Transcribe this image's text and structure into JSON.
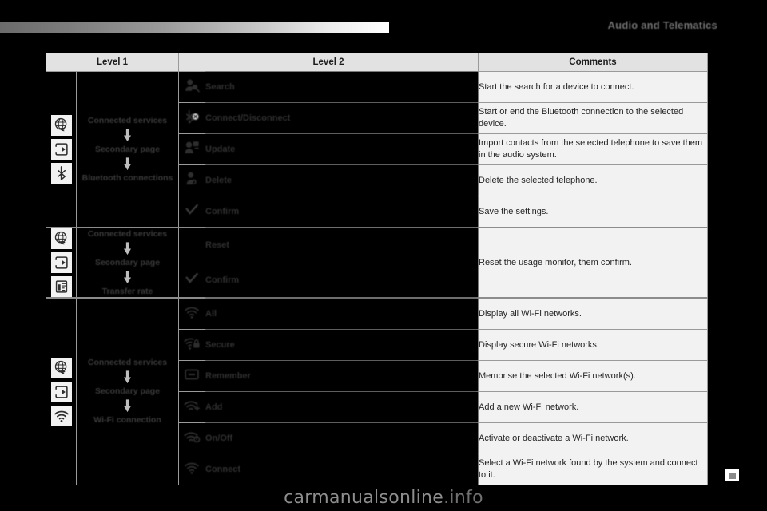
{
  "header": {
    "section_title": "Audio and Telematics"
  },
  "table": {
    "columns": {
      "level1": "Level 1",
      "level2": "Level 2",
      "comments": "Comments"
    },
    "groups": [
      {
        "level1": {
          "icons": [
            "globe-icon",
            "secondary-page-icon",
            "bluetooth-icon"
          ],
          "flow": [
            "Connected services",
            "Secondary page",
            "Bluetooth connections"
          ]
        },
        "rows": [
          {
            "icon": "search-person-icon",
            "label": "Search",
            "comment": "Start the search for a device to connect."
          },
          {
            "icon": "bluetooth-connect-icon",
            "label": "Connect/Disconnect",
            "comment": "Start or end the Bluetooth connection to the selected device."
          },
          {
            "icon": "update-contacts-icon",
            "label": "Update",
            "comment": "Import contacts from the selected telephone to save them in the audio system."
          },
          {
            "icon": "delete-person-icon",
            "label": "Delete",
            "comment": "Delete the selected telephone."
          },
          {
            "icon": "check-icon",
            "label": "Confirm",
            "comment": "Save the settings."
          }
        ]
      },
      {
        "level1": {
          "icons": [
            "globe-icon",
            "secondary-page-icon",
            "transfer-rate-icon"
          ],
          "flow": [
            "Connected services",
            "Secondary page",
            "Transfer rate"
          ]
        },
        "merged_comment": "Reset the usage monitor, them confirm.",
        "rows": [
          {
            "icon": "none",
            "label": "Reset"
          },
          {
            "icon": "check-icon",
            "label": "Confirm"
          }
        ]
      },
      {
        "level1": {
          "icons": [
            "globe-icon",
            "secondary-page-icon",
            "wifi-icon"
          ],
          "flow": [
            "Connected services",
            "Secondary page",
            "Wi-Fi connection"
          ]
        },
        "rows": [
          {
            "icon": "wifi-icon",
            "label": "All",
            "comment": "Display all Wi-Fi networks."
          },
          {
            "icon": "wifi-secure-icon",
            "label": "Secure",
            "comment": "Display secure Wi-Fi networks."
          },
          {
            "icon": "remember-icon",
            "label": "Remember",
            "comment": "Memorise the selected Wi-Fi network(s)."
          },
          {
            "icon": "wifi-add-icon",
            "label": "Add",
            "comment": "Add a new Wi-Fi network."
          },
          {
            "icon": "wifi-onoff-icon",
            "label": "On/Off",
            "comment": "Activate or deactivate a Wi-Fi network."
          },
          {
            "icon": "wifi-connect-icon",
            "label": "Connect",
            "comment": "Select a Wi-Fi network found by the system and connect to it."
          }
        ]
      }
    ]
  },
  "footer": {
    "watermark_main": "carmanualsonline",
    "watermark_tld": ".info"
  }
}
